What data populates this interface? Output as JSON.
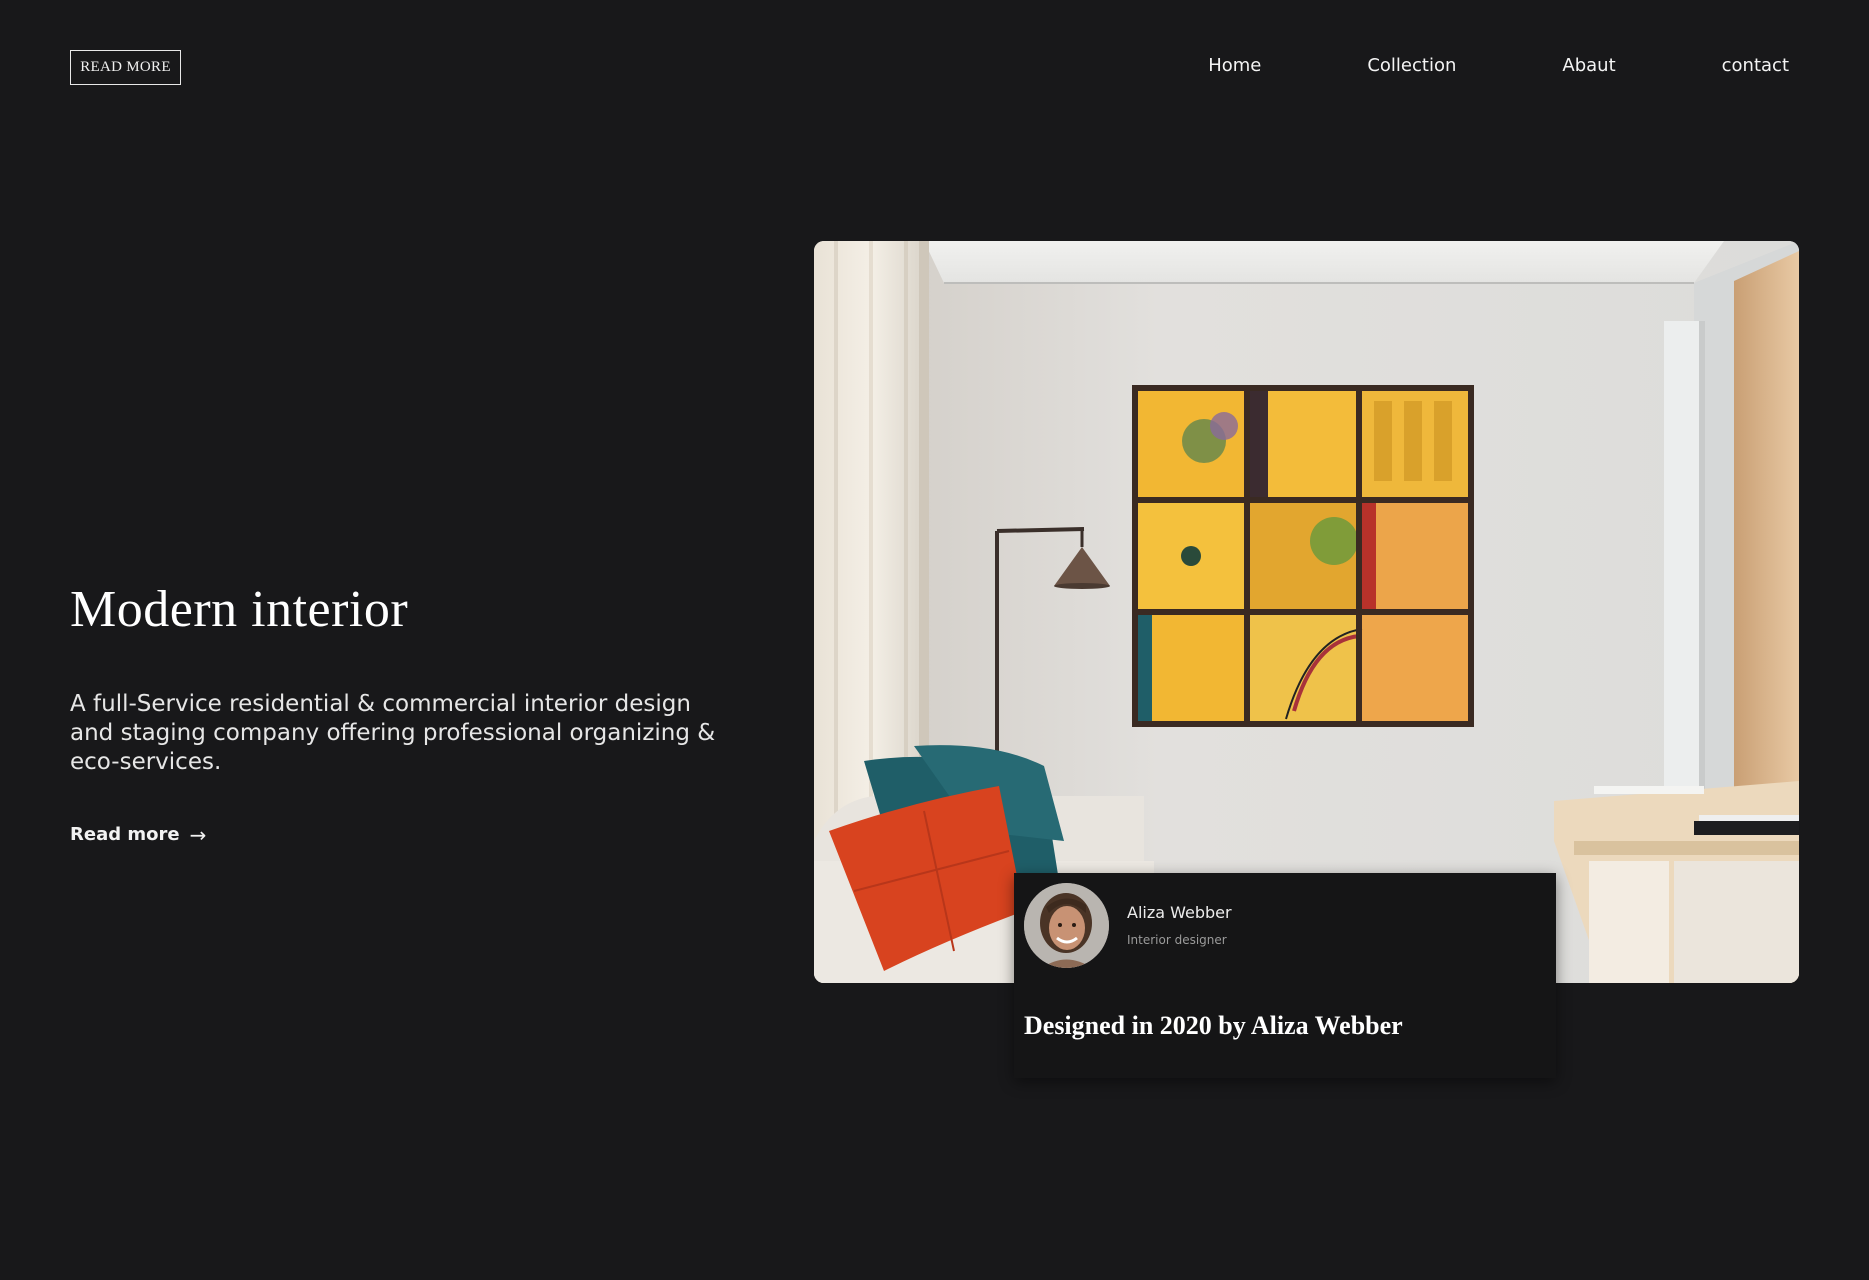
{
  "header": {
    "logo_label": "READ MORE",
    "nav": [
      {
        "label": "Home"
      },
      {
        "label": "Collection"
      },
      {
        "label": "Abaut"
      },
      {
        "label": "contact"
      }
    ]
  },
  "hero": {
    "title": "Modern interior",
    "description": "A full-Service residential & commercial interior design and staging company offering professional organizing & eco-services.",
    "cta_label": "Read more",
    "cta_icon": "arrow-right-icon"
  },
  "designer_card": {
    "name": "Aliza Webber",
    "role": "Interior designer",
    "caption": "Designed in 2020 by Aliza Webber"
  },
  "colors": {
    "background": "#18181a",
    "card_background": "#151516",
    "text": "#ffffff",
    "accent_yellow": "#f2b733",
    "accent_orange": "#d8431f",
    "accent_teal": "#1f5e68"
  }
}
